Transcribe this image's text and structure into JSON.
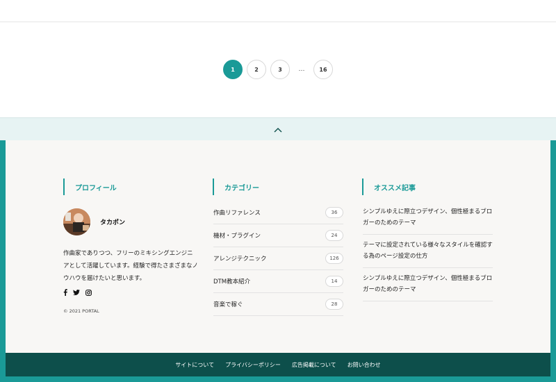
{
  "pagination": {
    "pages": [
      "1",
      "2",
      "3"
    ],
    "ellipsis": "…",
    "last": "16",
    "current": "1"
  },
  "colors": {
    "accent": "#1a9a97",
    "footer_bg": "#f8f7f5",
    "footer_bottom": "#0d4f4b",
    "totop_bg": "#e7f3f3"
  },
  "totop": {
    "icon": "chevron-up-icon"
  },
  "profile": {
    "title": "プロフィール",
    "name": "タカポン",
    "bio": "作曲家でありつつ、フリーのミキシングエンジニアとして活躍しています。経験で得たさまざまなノウハウを届けたいと思います。",
    "social_icons": [
      "facebook-icon",
      "twitter-icon",
      "instagram-icon"
    ],
    "copyright": "© 2021 PORTAL"
  },
  "categories": {
    "title": "カテゴリー",
    "items": [
      {
        "label": "作曲リファレンス",
        "count": "36"
      },
      {
        "label": "機材・プラグイン",
        "count": "24"
      },
      {
        "label": "アレンジテクニック",
        "count": "126"
      },
      {
        "label": "DTM教本紹介",
        "count": "14"
      },
      {
        "label": "音楽で稼ぐ",
        "count": "28"
      }
    ]
  },
  "recommended": {
    "title": "オススメ記事",
    "items": [
      {
        "title": "シンプルゆえに際立つデザイン、個性極まるブロガーのためのテーマ"
      },
      {
        "title": "テーマに設定されている様々なスタイルを確認する為のページ設定の仕方"
      },
      {
        "title": "シンプルゆえに際立つデザイン、個性極まるブロガーのためのテーマ"
      }
    ]
  },
  "footer_nav": {
    "links": [
      "サイトについて",
      "プライバシーポリシー",
      "広告掲載について",
      "お問い合わせ"
    ]
  }
}
